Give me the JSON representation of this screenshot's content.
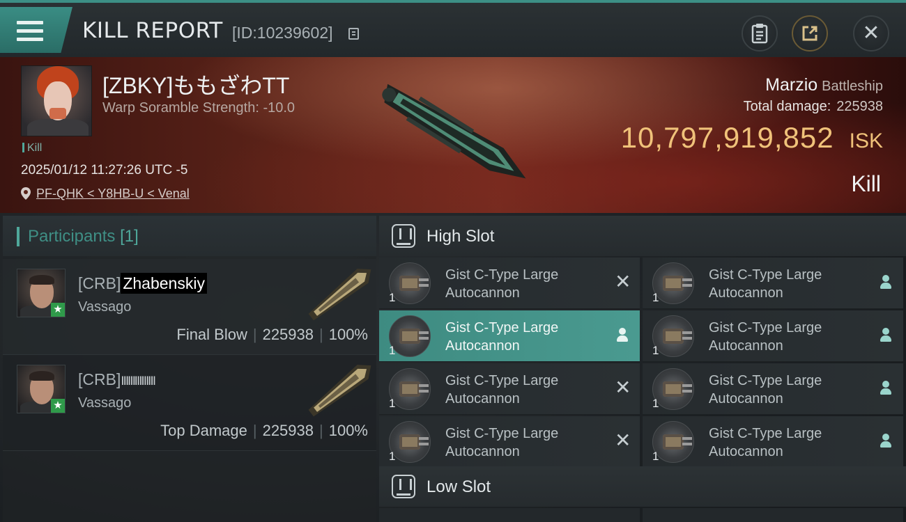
{
  "header": {
    "title": "KILL REPORT",
    "report_id": "[ID:10239602]",
    "icons": [
      "menu-icon",
      "copy-icon",
      "clipboard-icon",
      "share-icon",
      "close-icon"
    ]
  },
  "victim": {
    "name": "[ZBKY]ももざわTT",
    "warp_scramble": "Warp Soramble Strength: -10.0",
    "tag": "Kill",
    "datetime": "2025/01/12 11:27:26 UTC -5",
    "location": "PF-QHK < Y8HB-U < Venal",
    "ship_name": "Marzio",
    "ship_class": "Battleship",
    "total_damage_label": "Total damage:",
    "total_damage": "225938",
    "isk_value": "10,797,919,852",
    "isk_unit": "ISK",
    "result": "Kill"
  },
  "participants": {
    "label": "Participants",
    "count": "[1]",
    "list": [
      {
        "corp_tag": "[CRB]",
        "name": "Zhabenskiy",
        "corp": "Vassago",
        "role": "Final Blow",
        "damage": "225938",
        "percent": "100%"
      },
      {
        "corp_tag": "[CRB]",
        "name": "ⅢⅢⅢⅢⅢ",
        "corp": "Vassago",
        "role": "Top Damage",
        "damage": "225938",
        "percent": "100%"
      }
    ]
  },
  "slots": {
    "high": {
      "title": "High Slot",
      "modules": [
        {
          "qty": "1",
          "name_line1": "Gist C-Type Large",
          "name_line2": "Autocannon",
          "status": "destroyed"
        },
        {
          "qty": "1",
          "name_line1": "Gist C-Type Large",
          "name_line2": "Autocannon",
          "status": "dropped"
        },
        {
          "qty": "1",
          "name_line1": "Gist C-Type Large",
          "name_line2": "Autocannon",
          "status": "dropped"
        },
        {
          "qty": "1",
          "name_line1": "Gist C-Type Large",
          "name_line2": "Autocannon",
          "status": "dropped"
        },
        {
          "qty": "1",
          "name_line1": "Gist C-Type Large",
          "name_line2": "Autocannon",
          "status": "destroyed"
        },
        {
          "qty": "1",
          "name_line1": "Gist C-Type Large",
          "name_line2": "Autocannon",
          "status": "dropped"
        },
        {
          "qty": "1",
          "name_line1": "Gist C-Type Large",
          "name_line2": "Autocannon",
          "status": "destroyed"
        },
        {
          "qty": "1",
          "name_line1": "Gist C-Type Large",
          "name_line2": "Autocannon",
          "status": "dropped"
        }
      ]
    },
    "low": {
      "title": "Low Slot"
    }
  },
  "colors": {
    "accent": "#4fa89b",
    "isk": "#f0c27a",
    "dropped_bg": "#3e8b81"
  }
}
